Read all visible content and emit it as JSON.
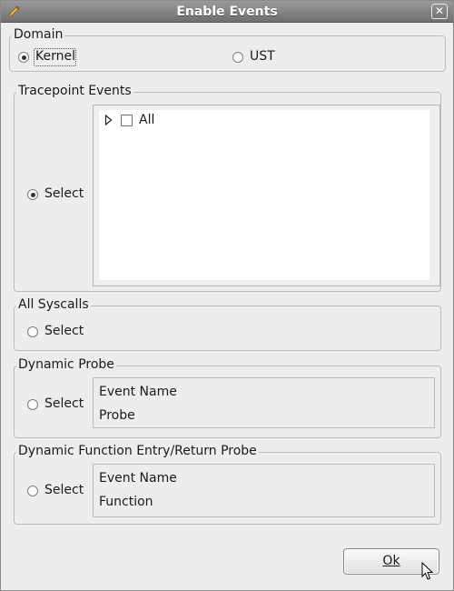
{
  "window": {
    "title": "Enable Events",
    "close_icon": "✕"
  },
  "domain": {
    "title": "Domain",
    "options": [
      {
        "label": "Kernel",
        "checked": true
      },
      {
        "label": "UST",
        "checked": false
      }
    ]
  },
  "tracepoint": {
    "title": "Tracepoint Events",
    "select_label": "Select",
    "select_checked": true,
    "tree": {
      "expander_icon": "▷",
      "item_label": "All",
      "item_checked": false
    }
  },
  "syscalls": {
    "title": "All Syscalls",
    "select_label": "Select",
    "select_checked": false
  },
  "dynamic_probe": {
    "title": "Dynamic Probe",
    "select_label": "Select",
    "select_checked": false,
    "event_name_label": "Event Name",
    "probe_label": "Probe"
  },
  "dynamic_function": {
    "title": "Dynamic Function Entry/Return Probe",
    "select_label": "Select",
    "select_checked": false,
    "event_name_label": "Event Name",
    "function_label": "Function"
  },
  "buttons": {
    "ok_label": "Ok"
  }
}
